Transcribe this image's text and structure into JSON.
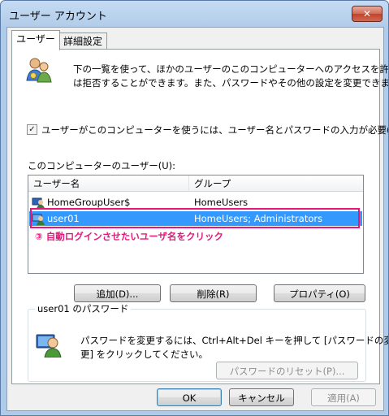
{
  "window": {
    "title": "ユーザー アカウント",
    "close_label": "✕"
  },
  "tabs": [
    {
      "label": "ユーザー"
    },
    {
      "label": "詳細設定"
    }
  ],
  "description": {
    "line1": "下の一覧を使って、ほかのユーザーのこのコンピューターへのアクセスを許可また",
    "line2": "は拒否することができます。また、パスワードやその他の設定を変更できます。"
  },
  "require_password": {
    "checked": "✓",
    "label": "ユーザーがこのコンピューターを使うには、ユーザー名とパスワードの入力が必要(E)"
  },
  "users_section": {
    "label": "このコンピューターのユーザー(U):"
  },
  "users_table": {
    "columns": [
      "ユーザー名",
      "グループ"
    ],
    "rows": [
      {
        "name": "HomeGroupUser$",
        "group": "HomeUsers"
      },
      {
        "name": "user01",
        "group": "HomeUsers; Administrators"
      }
    ]
  },
  "annotation": "③ 自動ログインさせたいユーザ名をクリック",
  "user_buttons": {
    "add": "追加(D)...",
    "remove": "削除(R)",
    "properties": "プロパティ(O)"
  },
  "password_group": {
    "label": "user01 のパスワード",
    "line1": "パスワードを変更するには、Ctrl+Alt+Del キーを押して [パスワードの変",
    "line2": "更] をクリックしてください。",
    "reset_button": "パスワードのリセット(P)..."
  },
  "dialog_buttons": {
    "ok": "OK",
    "cancel": "キャンセル",
    "apply": "適用(A)"
  }
}
